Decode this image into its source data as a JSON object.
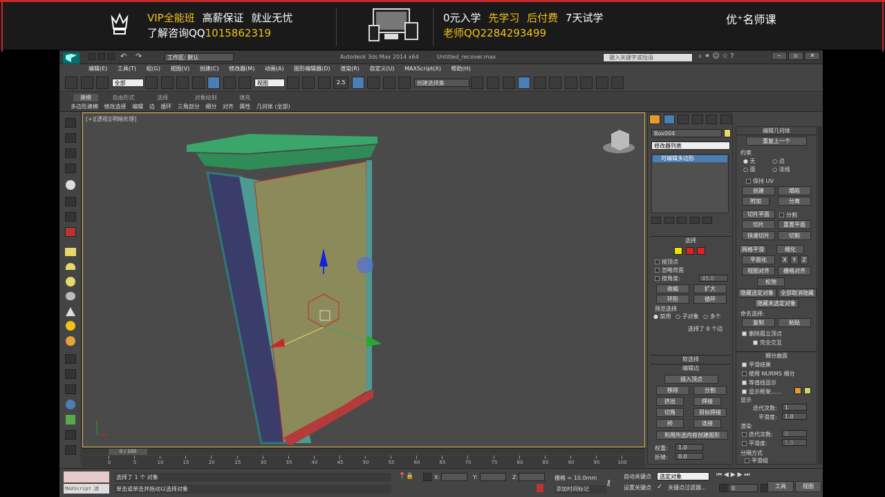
{
  "ad": {
    "vip": "VIP全能班",
    "guarantee": "高薪保证",
    "employment": "就业无忧",
    "consult_label": "了解咨询QQ",
    "consult_qq": "1015862319",
    "free_admission": "0元入学",
    "learn_first": "先学习",
    "pay_later": "后付费",
    "trial": "7天试学",
    "teacher_label": "老师QQ",
    "teacher_qq": "2284293499",
    "brand": "优⁺名师课"
  },
  "window": {
    "title_app": "Autodesk 3ds Max  2014 x64",
    "title_file": "Untitled_recover.max",
    "workspace": "工作区: 默认",
    "search_placeholder": "键入关键字或短语"
  },
  "menu": [
    "编辑(E)",
    "工具(T)",
    "组(G)",
    "视图(V)",
    "创建(C)",
    "修改器(M)",
    "动画(A)",
    "图形编辑器(D)",
    "渲染(R)",
    "自定义(U)",
    "MAXScript(X)",
    "帮助(H)"
  ],
  "toolbar": {
    "filter": "全部",
    "view": "视图",
    "spinner_label": "2.5",
    "selection_set": "创建选择集"
  },
  "ribbon": {
    "tabs": [
      "建模",
      "自由形式",
      "选择",
      "对象绘制",
      "填充"
    ],
    "items": [
      "多边形建模",
      "修改选择",
      "编辑",
      "边",
      "循环",
      "三角剖分",
      "细分",
      "对齐",
      "属性",
      "几何体 (全部)"
    ]
  },
  "viewport": {
    "label": "[+][透视][明暗处理]"
  },
  "command_panel": {
    "object_name": "Box004",
    "modifier_list": "修改器列表",
    "stack_item": "可编辑多边形",
    "selection": {
      "title": "选择",
      "by_vertex": "按顶点",
      "ignore_backface": "忽略背面",
      "by_angle": "按角度:",
      "angle_value": "45.0",
      "shrink": "收缩",
      "grow": "扩大",
      "ring": "环形",
      "loop": "循环",
      "preview_selection": "预览选择",
      "disabled": "禁用",
      "sub_object": "子对象",
      "multi": "多个",
      "status": "选择了 8 个边"
    },
    "soft_selection": "软选择",
    "edit_edges": {
      "title": "编辑边",
      "insert_vertex": "插入顶点",
      "remove": "移除",
      "split": "分割",
      "extrude": "挤出",
      "weld": "焊接",
      "chamfer": "切角",
      "target_weld": "目标焊接",
      "bridge": "桥",
      "connect": "连接",
      "create_shape": "利用所选内容创建图形",
      "weight_label": "权重:",
      "weight_value": "1.0",
      "crease_label": "折缝:",
      "crease_value": "0.0"
    }
  },
  "right_panel": {
    "edit_geometry": "编辑几何体",
    "repeat_last": "重复上一个",
    "constraints": "约束",
    "c_none": "无",
    "c_edge": "边",
    "c_face": "面",
    "c_normal": "法线",
    "preserve_uv": "保持 UV",
    "create": "创建",
    "collapse": "塌陷",
    "attach": "附加",
    "detach": "分离",
    "slice_plane": "切片平面",
    "split": "分割",
    "slice": "切片",
    "reset_plane": "重置平面",
    "quickslice": "快速切片",
    "cut": "切割",
    "meshsmooth": "网格平滑",
    "tessellate": "细化",
    "planarize": "平面化",
    "x": "X",
    "y": "Y",
    "z": "Z",
    "view_align": "视图对齐",
    "grid_align": "栅格对齐",
    "relax": "松弛",
    "hide_selected": "隐藏选定对象",
    "unhide_all": "全部取消隐藏",
    "hide_unselected": "隐藏未选定对象",
    "named_selections": "命名选择:",
    "copy": "复制",
    "paste": "粘贴",
    "delete_isolated": "删除孤立顶点",
    "full_interactivity": "完全交互",
    "subdivision_surface": "细分曲面",
    "smooth_result": "平滑结果",
    "use_nurms": "使用 NURMS 细分",
    "isoline_display": "等值线显示",
    "show_cage": "显示框架......",
    "display": "显示",
    "iterations": "迭代次数:",
    "iter_value": "1",
    "smoothness": "平滑度:",
    "smooth_value": "1.0",
    "render": "渲染",
    "r_iter_value": "0",
    "r_smooth_value": "1.0",
    "separate_by": "分隔方式",
    "smoothing_groups": "平滑组"
  },
  "timeline": {
    "frame": "0 / 100",
    "ticks": [
      "0",
      "5",
      "10",
      "15",
      "20",
      "25",
      "30",
      "35",
      "40",
      "45",
      "50",
      "55",
      "60",
      "65",
      "70",
      "75",
      "80",
      "85",
      "90",
      "95",
      "100"
    ]
  },
  "status": {
    "maxscript": "MAXScript 迷",
    "selected": "选择了 1 个 对象",
    "prompt": "单击或单击并拖动以选择对象",
    "x_label": "X:",
    "y_label": "Y:",
    "z_label": "Z:",
    "grid": "栅格 = 10.0mm",
    "auto_key": "自动关键点",
    "selected_obj": "选定对象",
    "set_key": "设置关键点",
    "key_filters": "关键点过滤器...",
    "add_time_tag": "添加时间标记",
    "frame_value": "0",
    "workspace_btn": "工具",
    "view_btn": "视图"
  },
  "colors": {
    "viewport_bg": "#4a4a4a",
    "object_green": "#3aa66a",
    "object_panel": "#8b8a5a",
    "accent_red": "#c62828",
    "ad_yellow": "#f2c21b"
  }
}
